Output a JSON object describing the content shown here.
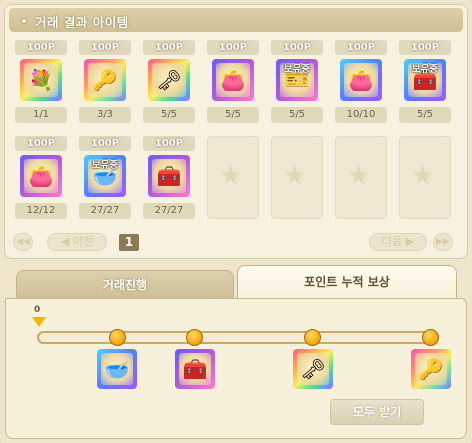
{
  "header": {
    "title": "거래 결과 아이템"
  },
  "items": [
    {
      "price": "100P",
      "count": "1/1",
      "icon": "flower-basket-icon",
      "glyph": "💐",
      "bg": "rb1",
      "tag": ""
    },
    {
      "price": "100P",
      "count": "3/3",
      "icon": "magic-key-icon",
      "glyph": "🔑",
      "bg": "rb2",
      "tag": ""
    },
    {
      "price": "100P",
      "count": "5/5",
      "icon": "golden-key-icon",
      "glyph": "🗝",
      "bg": "rb1",
      "tag": ""
    },
    {
      "price": "100P",
      "count": "5/5",
      "icon": "coin-pouch-icon",
      "glyph": "👛",
      "bg": "purple",
      "tag": ""
    },
    {
      "price": "100P",
      "count": "5/5",
      "icon": "ticket-icon",
      "glyph": "🎫",
      "bg": "purple",
      "tag": "보유중"
    },
    {
      "price": "100P",
      "count": "10/10",
      "icon": "coin-pouch-icon",
      "glyph": "👛",
      "bg": "blue",
      "tag": ""
    },
    {
      "price": "100P",
      "count": "5/5",
      "icon": "treasure-chest-icon",
      "glyph": "🧰",
      "bg": "blue",
      "tag": "보유중"
    },
    {
      "price": "100P",
      "count": "12/12",
      "icon": "coin-pouch-icon",
      "glyph": "👛",
      "bg": "purple",
      "tag": ""
    },
    {
      "price": "100P",
      "count": "27/27",
      "icon": "ingot-icon",
      "glyph": "🥣",
      "bg": "blue",
      "tag": "보유중"
    },
    {
      "price": "100P",
      "count": "27/27",
      "icon": "treasure-chest-icon",
      "glyph": "🧰",
      "bg": "purple",
      "tag": ""
    }
  ],
  "pager": {
    "prev_label": "◀ 이전",
    "next_label": "다음 ▶",
    "first_label": "◀◀",
    "last_label": "▶▶",
    "current_page": "1"
  },
  "tabs": {
    "trade_progress": "거래진행",
    "point_reward": "포인트 누적 보상"
  },
  "progress": {
    "start_label": "0",
    "current_value": 0
  },
  "rewards": [
    {
      "icon": "ingot-icon",
      "glyph": "🥣",
      "bg": "blue"
    },
    {
      "icon": "treasure-chest-icon",
      "glyph": "🧰",
      "bg": "purple"
    },
    {
      "icon": "golden-key-icon",
      "glyph": "🗝",
      "bg": "rb1"
    },
    {
      "icon": "magic-key-icon",
      "glyph": "🔑",
      "bg": "rb2"
    }
  ],
  "actions": {
    "claim_all_label": "모두 받기"
  }
}
